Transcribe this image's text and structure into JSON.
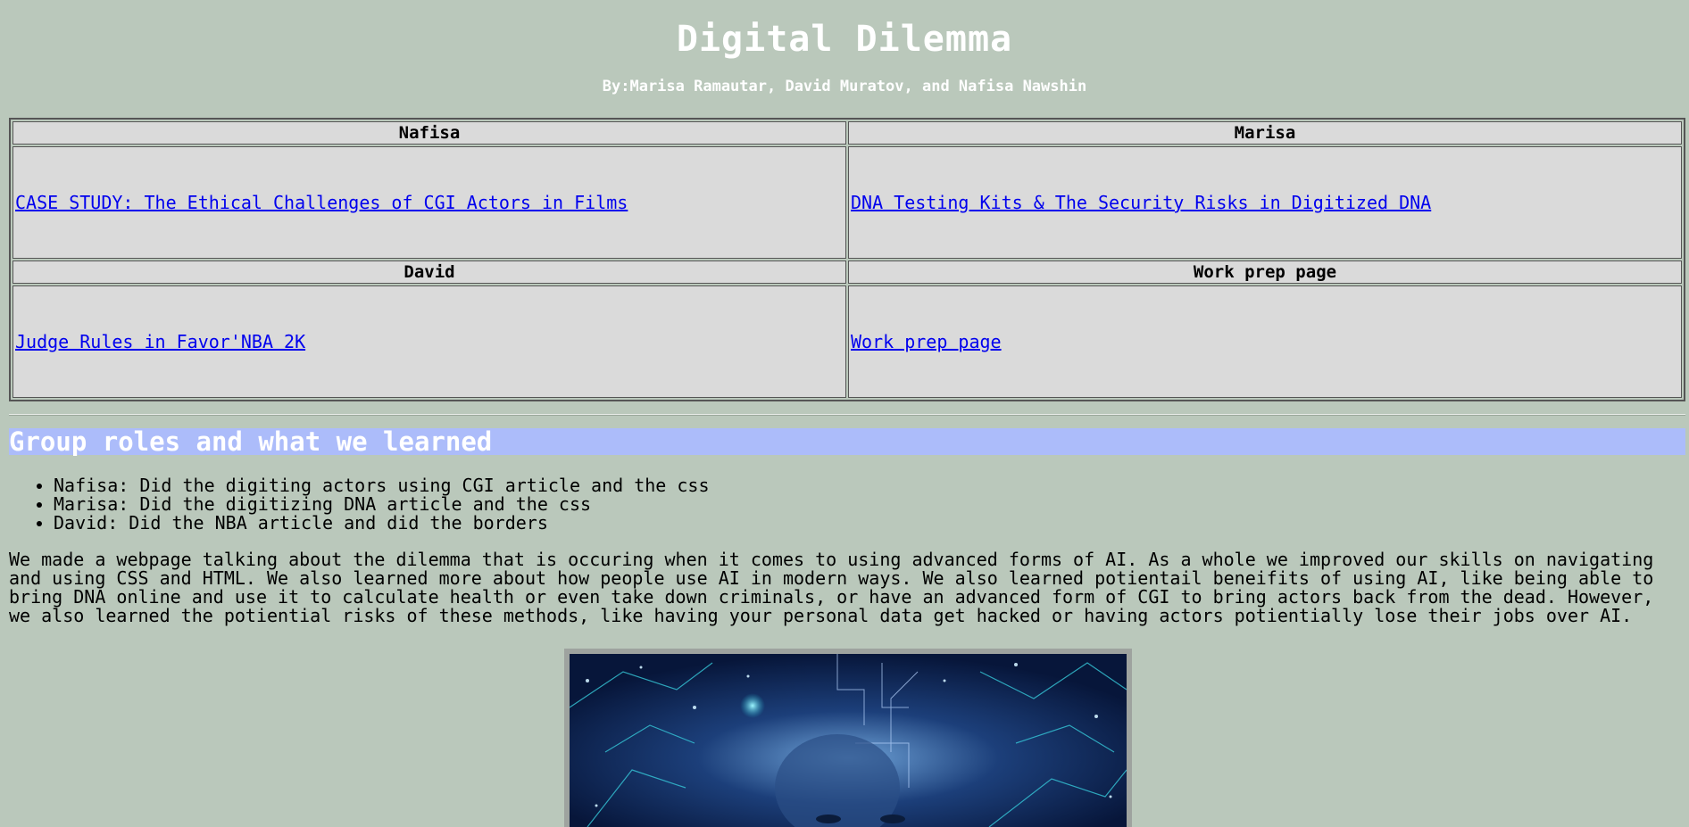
{
  "header": {
    "title": "Digital Dilemma",
    "byline": "By:Marisa Ramautar, David Muratov, and Nafisa Nawshin"
  },
  "table": {
    "rows": [
      {
        "headers": [
          "Nafisa",
          "Marisa"
        ],
        "links": [
          "CASE STUDY: The Ethical Challenges of CGI Actors in Films",
          "DNA Testing Kits & The Security Risks in Digitized DNA"
        ]
      },
      {
        "headers": [
          "David",
          "Work prep page"
        ],
        "links": [
          "Judge Rules in Favor'NBA 2K",
          "Work prep page"
        ]
      }
    ]
  },
  "section": {
    "heading": "Group roles and what we learned",
    "roles": [
      "Nafisa: Did the digiting actors using CGI article and the css",
      "Marisa: Did the digitizing DNA article and the css",
      "David: Did the NBA article and did the borders"
    ],
    "summary": "We made a webpage talking about the dilemma that is occuring when it comes to using advanced forms of AI. As a whole we improved our skills on navigating and using CSS and HTML. We also learned more about how people use AI in modern ways. We also learned potientail beneifits of using AI, like being able to bring DNA online and use it to calculate health or even take down criminals, or have an advanced form of CGI to bring actors back from the dead. However, we also learned the potiential risks of these methods, like having your personal data get hacked or having actors potientially lose their jobs over AI."
  },
  "colors": {
    "background": "#bac8bb",
    "cell": "#dadada",
    "link": "#0000ee",
    "section_band": "#acbcfa",
    "heading_text": "#ffffff"
  }
}
